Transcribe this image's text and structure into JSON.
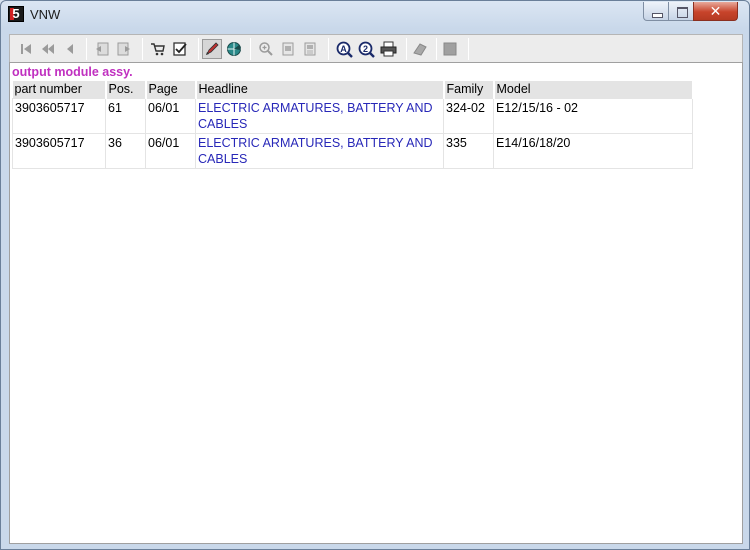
{
  "window": {
    "title": "VNW",
    "app_icon_letter": "5",
    "close_symbol": "✕"
  },
  "toolbar": {
    "buttons": [
      {
        "name": "first-record-button",
        "icon": "skip-first-icon",
        "enabled": false
      },
      {
        "name": "prev-page-button",
        "icon": "double-left-icon",
        "enabled": false
      },
      {
        "name": "prev-record-button",
        "icon": "left-arrow-icon",
        "enabled": false
      },
      {
        "name": "back-document-button",
        "icon": "page-back-icon",
        "enabled": false
      },
      {
        "name": "forward-document-button",
        "icon": "page-forward-icon",
        "enabled": false
      },
      {
        "name": "cart-button",
        "icon": "cart-icon",
        "enabled": true
      },
      {
        "name": "checklist-button",
        "icon": "checklist-icon",
        "enabled": true
      },
      {
        "name": "mark-button",
        "icon": "pen-icon",
        "enabled": true
      },
      {
        "name": "globe-button",
        "icon": "globe-icon",
        "enabled": true
      },
      {
        "name": "zoom-in-button",
        "icon": "magnifier-icon",
        "enabled": false
      },
      {
        "name": "page-view-button",
        "icon": "page-icon",
        "enabled": false
      },
      {
        "name": "page-view-alt-button",
        "icon": "page-alt-icon",
        "enabled": false
      },
      {
        "name": "search-a-button",
        "icon": "search-a-icon",
        "enabled": true
      },
      {
        "name": "search-2-button",
        "icon": "search-2-icon",
        "enabled": true
      },
      {
        "name": "print-button",
        "icon": "printer-icon",
        "enabled": true
      },
      {
        "name": "edit-button",
        "icon": "eraser-icon",
        "enabled": false
      },
      {
        "name": "stop-button",
        "icon": "square-icon",
        "enabled": false
      }
    ]
  },
  "results": {
    "title": "output module assy.",
    "columns": [
      "part number",
      "Pos.",
      "Page",
      "Headline",
      "Family",
      "Model"
    ],
    "rows": [
      {
        "part_number": "3903605717",
        "pos": "61",
        "page": "06/01",
        "headline": "ELECTRIC ARMATURES, BATTERY AND CABLES",
        "family": "324-02",
        "model": "E12/15/16 - 02"
      },
      {
        "part_number": "3903605717",
        "pos": "36",
        "page": "06/01",
        "headline": "ELECTRIC ARMATURES, BATTERY AND CABLES",
        "family": "335",
        "model": "E14/16/18/20"
      }
    ]
  },
  "colors": {
    "section_title": "#c030c0",
    "headline_link": "#2828b8",
    "header_bg": "#e4e4e4"
  }
}
